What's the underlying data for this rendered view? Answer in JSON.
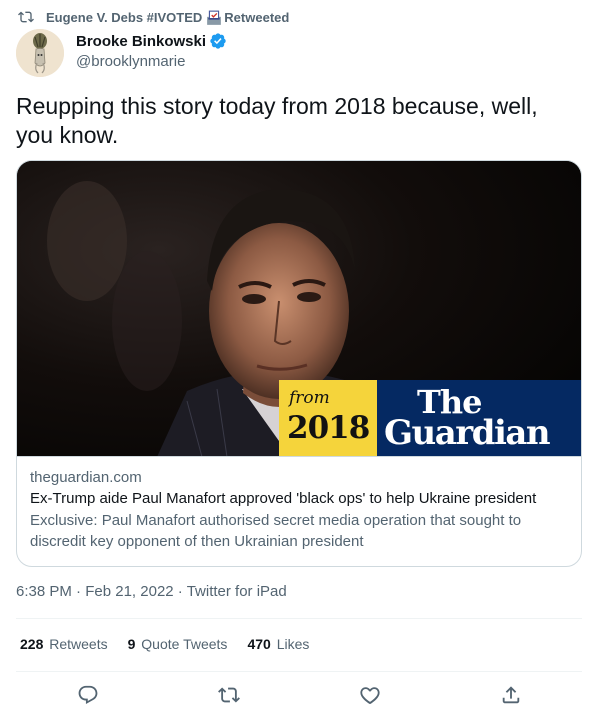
{
  "retweet": {
    "retweeter_name": "Eugene V. Debs #IVOTED",
    "retweeted_label": "Retweeted",
    "icons": [
      "retweet-icon",
      "ballot-box-icon"
    ]
  },
  "author": {
    "display_name": "Brooke Binkowski",
    "handle": "@brooklynmarie",
    "verified": true,
    "icons": [
      "verified-badge-icon"
    ]
  },
  "tweet": {
    "text": "Reupping this story today from 2018 because, well, you know."
  },
  "card": {
    "image_badge": {
      "from_label": "from",
      "year": "2018",
      "brand_line1": "The",
      "brand_line2": "Guardian"
    },
    "domain": "theguardian.com",
    "title": "Ex-Trump aide Paul Manafort approved 'black ops' to help Ukraine president",
    "description": "Exclusive: Paul Manafort authorised secret media operation that sought to discredit key opponent of then Ukrainian president"
  },
  "meta": {
    "time": "6:38 PM",
    "separator": "·",
    "date": "Feb 21, 2022",
    "source": "Twitter for iPad"
  },
  "stats": {
    "retweets_count": "228",
    "retweets_label": "Retweets",
    "quotes_count": "9",
    "quotes_label": "Quote Tweets",
    "likes_count": "470",
    "likes_label": "Likes"
  },
  "actions": [
    "reply-icon",
    "retweet-icon",
    "like-icon",
    "share-icon"
  ],
  "colors": {
    "text_primary": "#0f1419",
    "text_secondary": "#536471",
    "border": "#cfd9de",
    "verified_blue": "#1d9bf0",
    "badge_yellow": "#f5d43b",
    "guardian_blue": "#052962"
  }
}
